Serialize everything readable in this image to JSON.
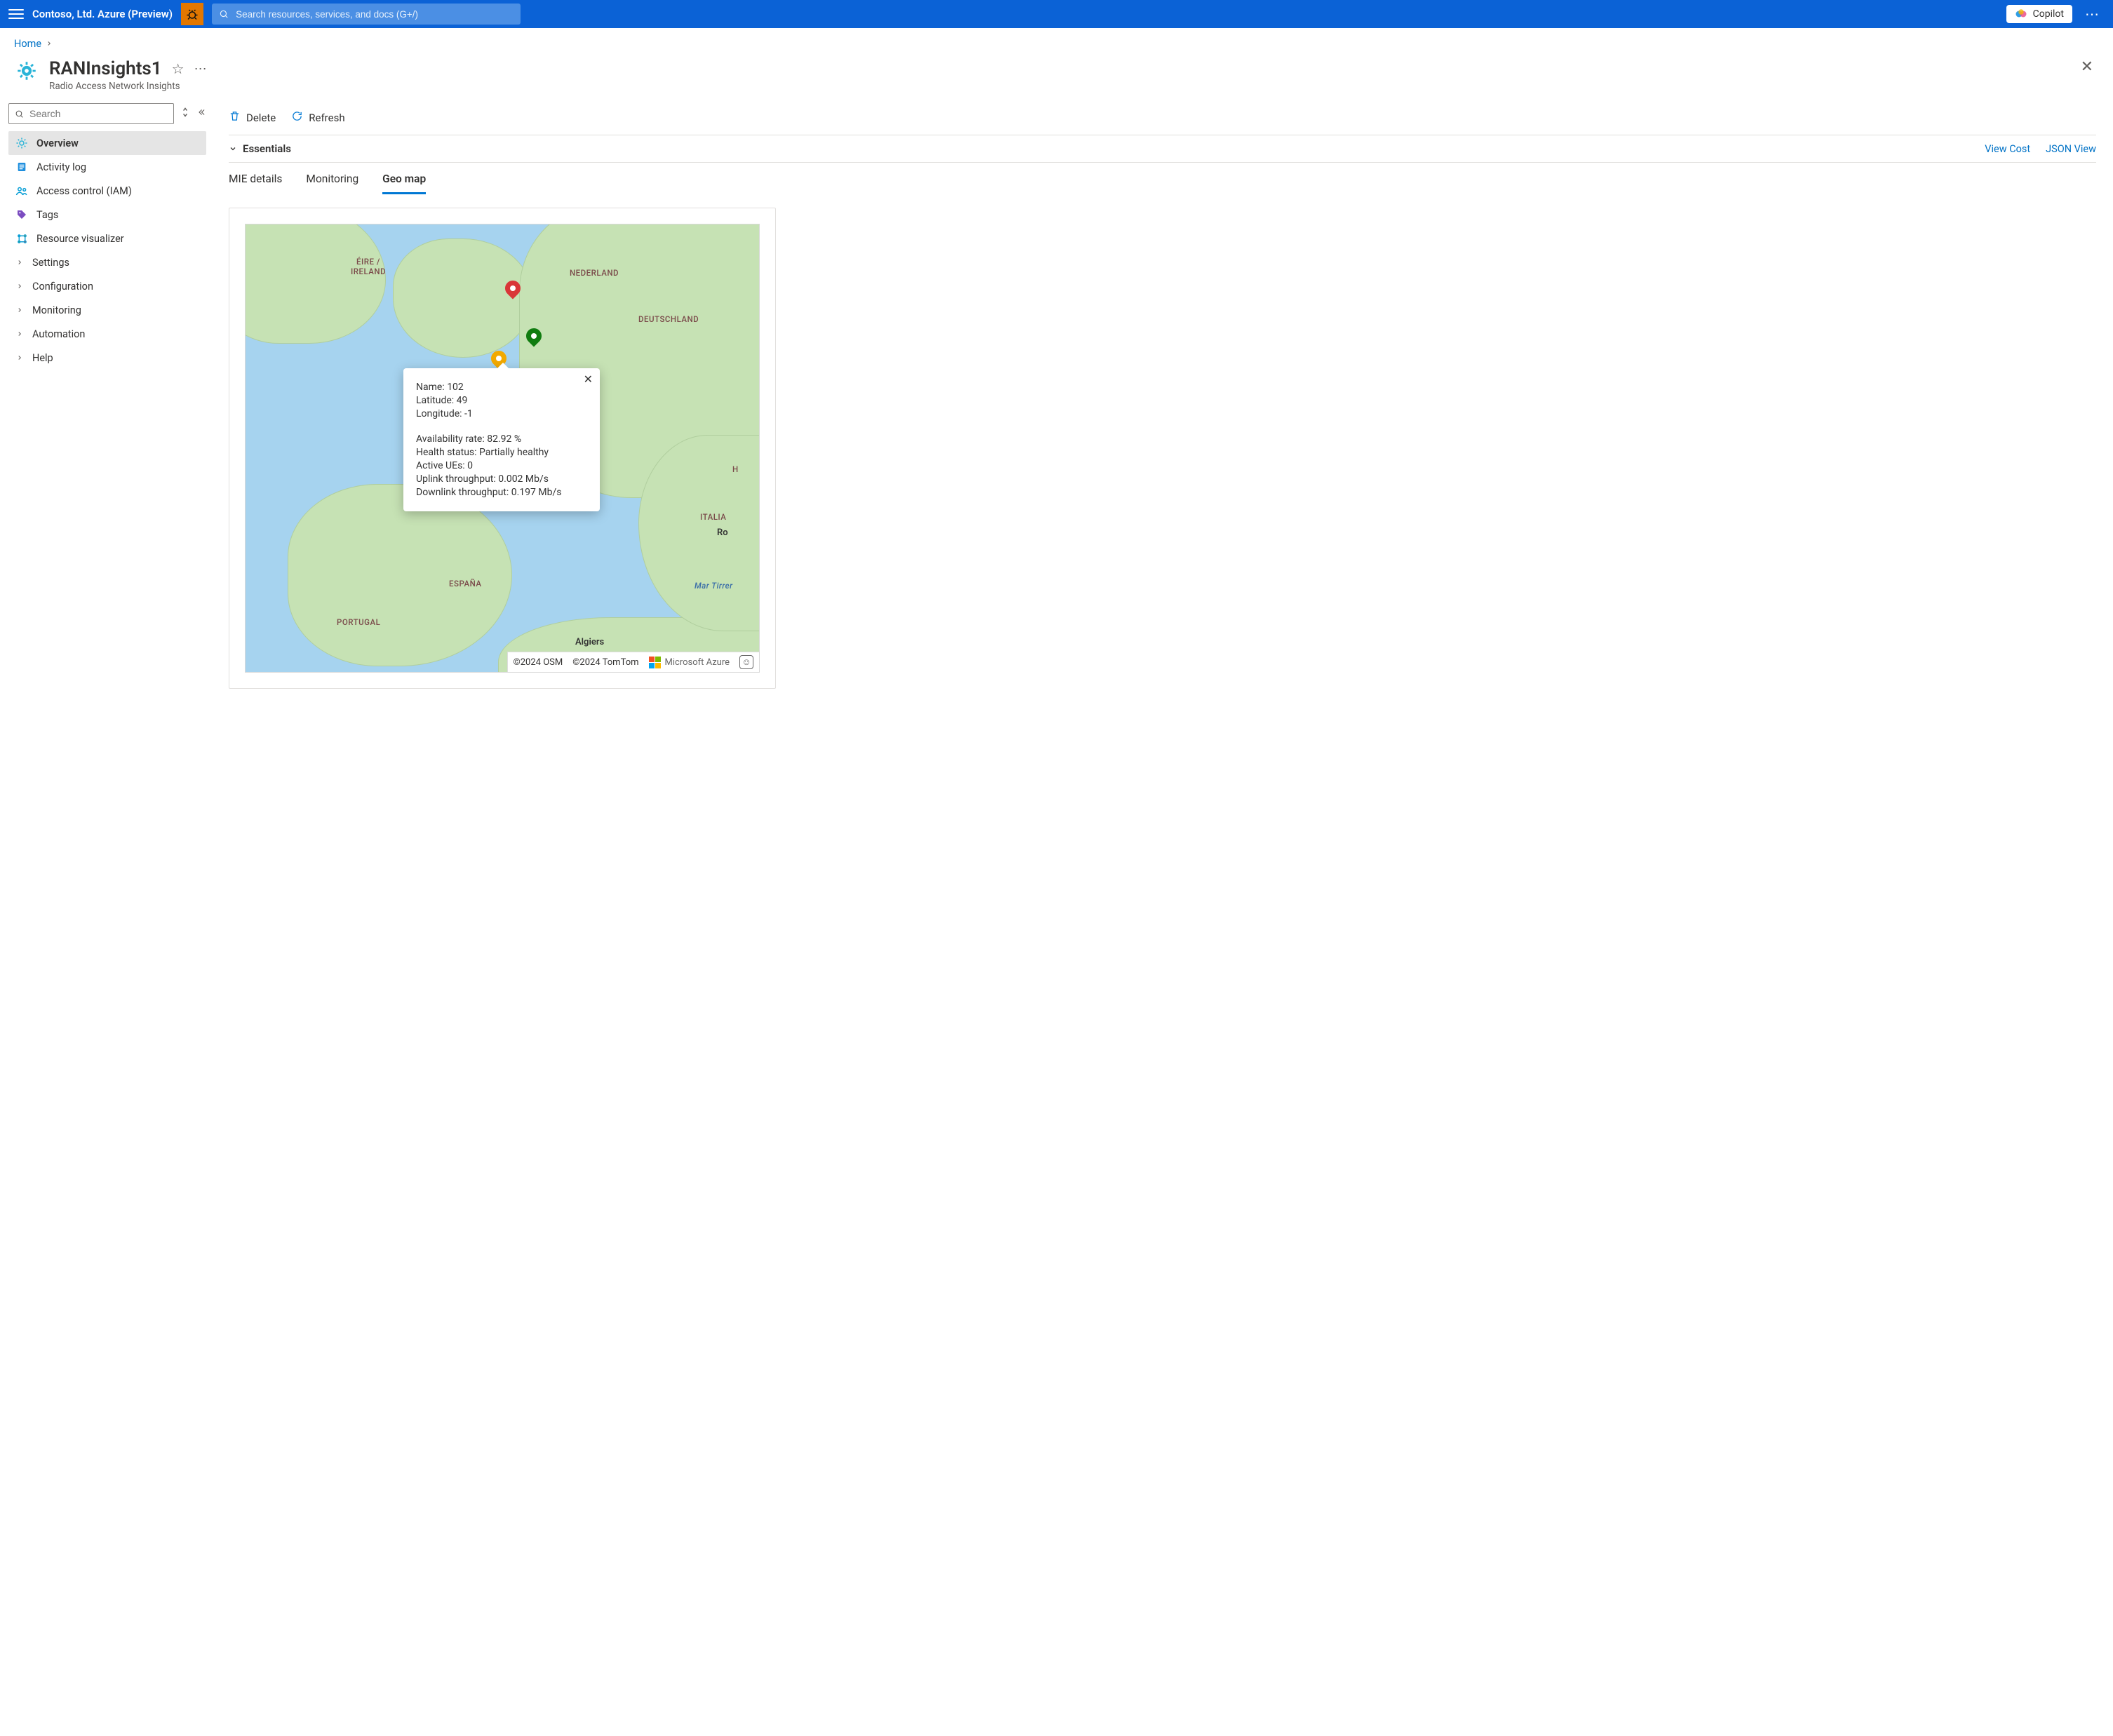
{
  "topbar": {
    "tenant": "Contoso, Ltd. Azure (Preview)",
    "search_placeholder": "Search resources, services, and docs (G+/)",
    "copilot": "Copilot"
  },
  "breadcrumb": {
    "home": "Home"
  },
  "header": {
    "title": "RANInsights1",
    "subtitle": "Radio Access Network Insights"
  },
  "sidebar": {
    "search_placeholder": "Search",
    "items": [
      {
        "label": "Overview"
      },
      {
        "label": "Activity log"
      },
      {
        "label": "Access control (IAM)"
      },
      {
        "label": "Tags"
      },
      {
        "label": "Resource visualizer"
      },
      {
        "label": "Settings"
      },
      {
        "label": "Configuration"
      },
      {
        "label": "Monitoring"
      },
      {
        "label": "Automation"
      },
      {
        "label": "Help"
      }
    ]
  },
  "commands": {
    "delete": "Delete",
    "refresh": "Refresh"
  },
  "essentials": {
    "label": "Essentials",
    "view_cost": "View Cost",
    "json_view": "JSON View"
  },
  "tabs": {
    "mie": "MIE details",
    "monitoring": "Monitoring",
    "geomap": "Geo map"
  },
  "map": {
    "labels": {
      "ireland1": "ÉIRE /",
      "ireland2": "IRELAND",
      "nederland": "NEDERLAND",
      "deutschland": "DEUTSCHLAND",
      "italia": "ITALIA",
      "roma": "Ro",
      "espana": "ESPAÑA",
      "portugal": "PORTUGAL",
      "algiers": "Algiers",
      "martirrer": "Mar Tirrer",
      "h": "H"
    },
    "popup": {
      "name_label": "Name:",
      "name_value": "102",
      "lat_label": "Latitude:",
      "lat_value": "49",
      "lon_label": "Longitude:",
      "lon_value": "-1",
      "avail_label": "Availability rate:",
      "avail_value": "82.92 %",
      "health_label": "Health status:",
      "health_value": "Partially healthy",
      "ues_label": "Active UEs:",
      "ues_value": "0",
      "ul_label": "Uplink throughput:",
      "ul_value": "0.002 Mb/s",
      "dl_label": "Downlink throughput:",
      "dl_value": "0.197 Mb/s"
    },
    "footer": {
      "osm": "©2024 OSM",
      "tomtom": "©2024 TomTom",
      "msazure": "Microsoft Azure"
    }
  }
}
